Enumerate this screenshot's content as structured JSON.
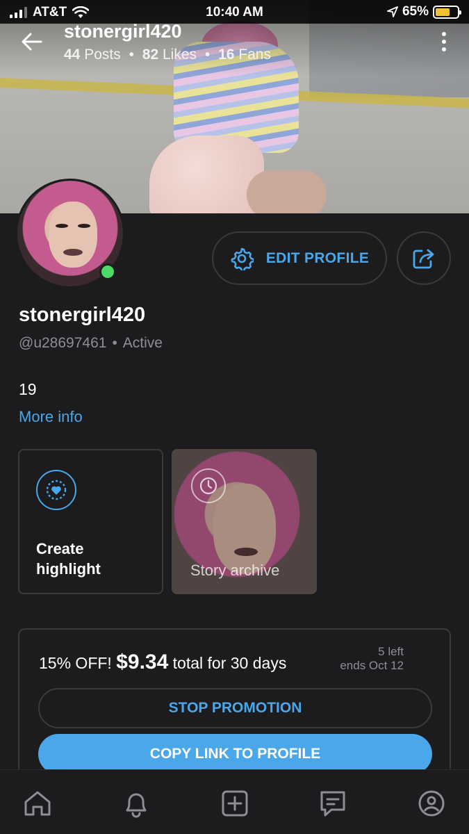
{
  "status_bar": {
    "carrier": "AT&T",
    "time": "10:40 AM",
    "battery_percent": "65%",
    "battery_level": 0.65
  },
  "header": {
    "username": "stonergirl420",
    "posts_count": "44",
    "posts_label": "Posts",
    "likes_count": "82",
    "likes_label": "Likes",
    "fans_count": "16",
    "fans_label": "Fans",
    "separator": "•"
  },
  "profile": {
    "edit_label": "EDIT PROFILE",
    "display_name": "stonergirl420",
    "handle": "@u28697461",
    "separator": "•",
    "status": "Active",
    "bio": "19",
    "more_info": "More info"
  },
  "stories": {
    "create_label": "Create highlight",
    "archive_label": "Story archive"
  },
  "promotion": {
    "discount": "15% OFF!",
    "price": "$9.34",
    "terms": "total for 30 days",
    "left": "5 left",
    "ends": "ends Oct 12",
    "stop_label": "STOP PROMOTION",
    "copy_label": "COPY LINK TO PROFILE"
  },
  "bottom_nav": {
    "items": [
      "home-icon",
      "bell-icon",
      "plus-square-icon",
      "messages-icon",
      "profile-icon"
    ]
  },
  "colors": {
    "accent": "#4aa7ea",
    "background": "#1c1c1e",
    "online": "#4cd964",
    "muted": "#8e8e93"
  }
}
